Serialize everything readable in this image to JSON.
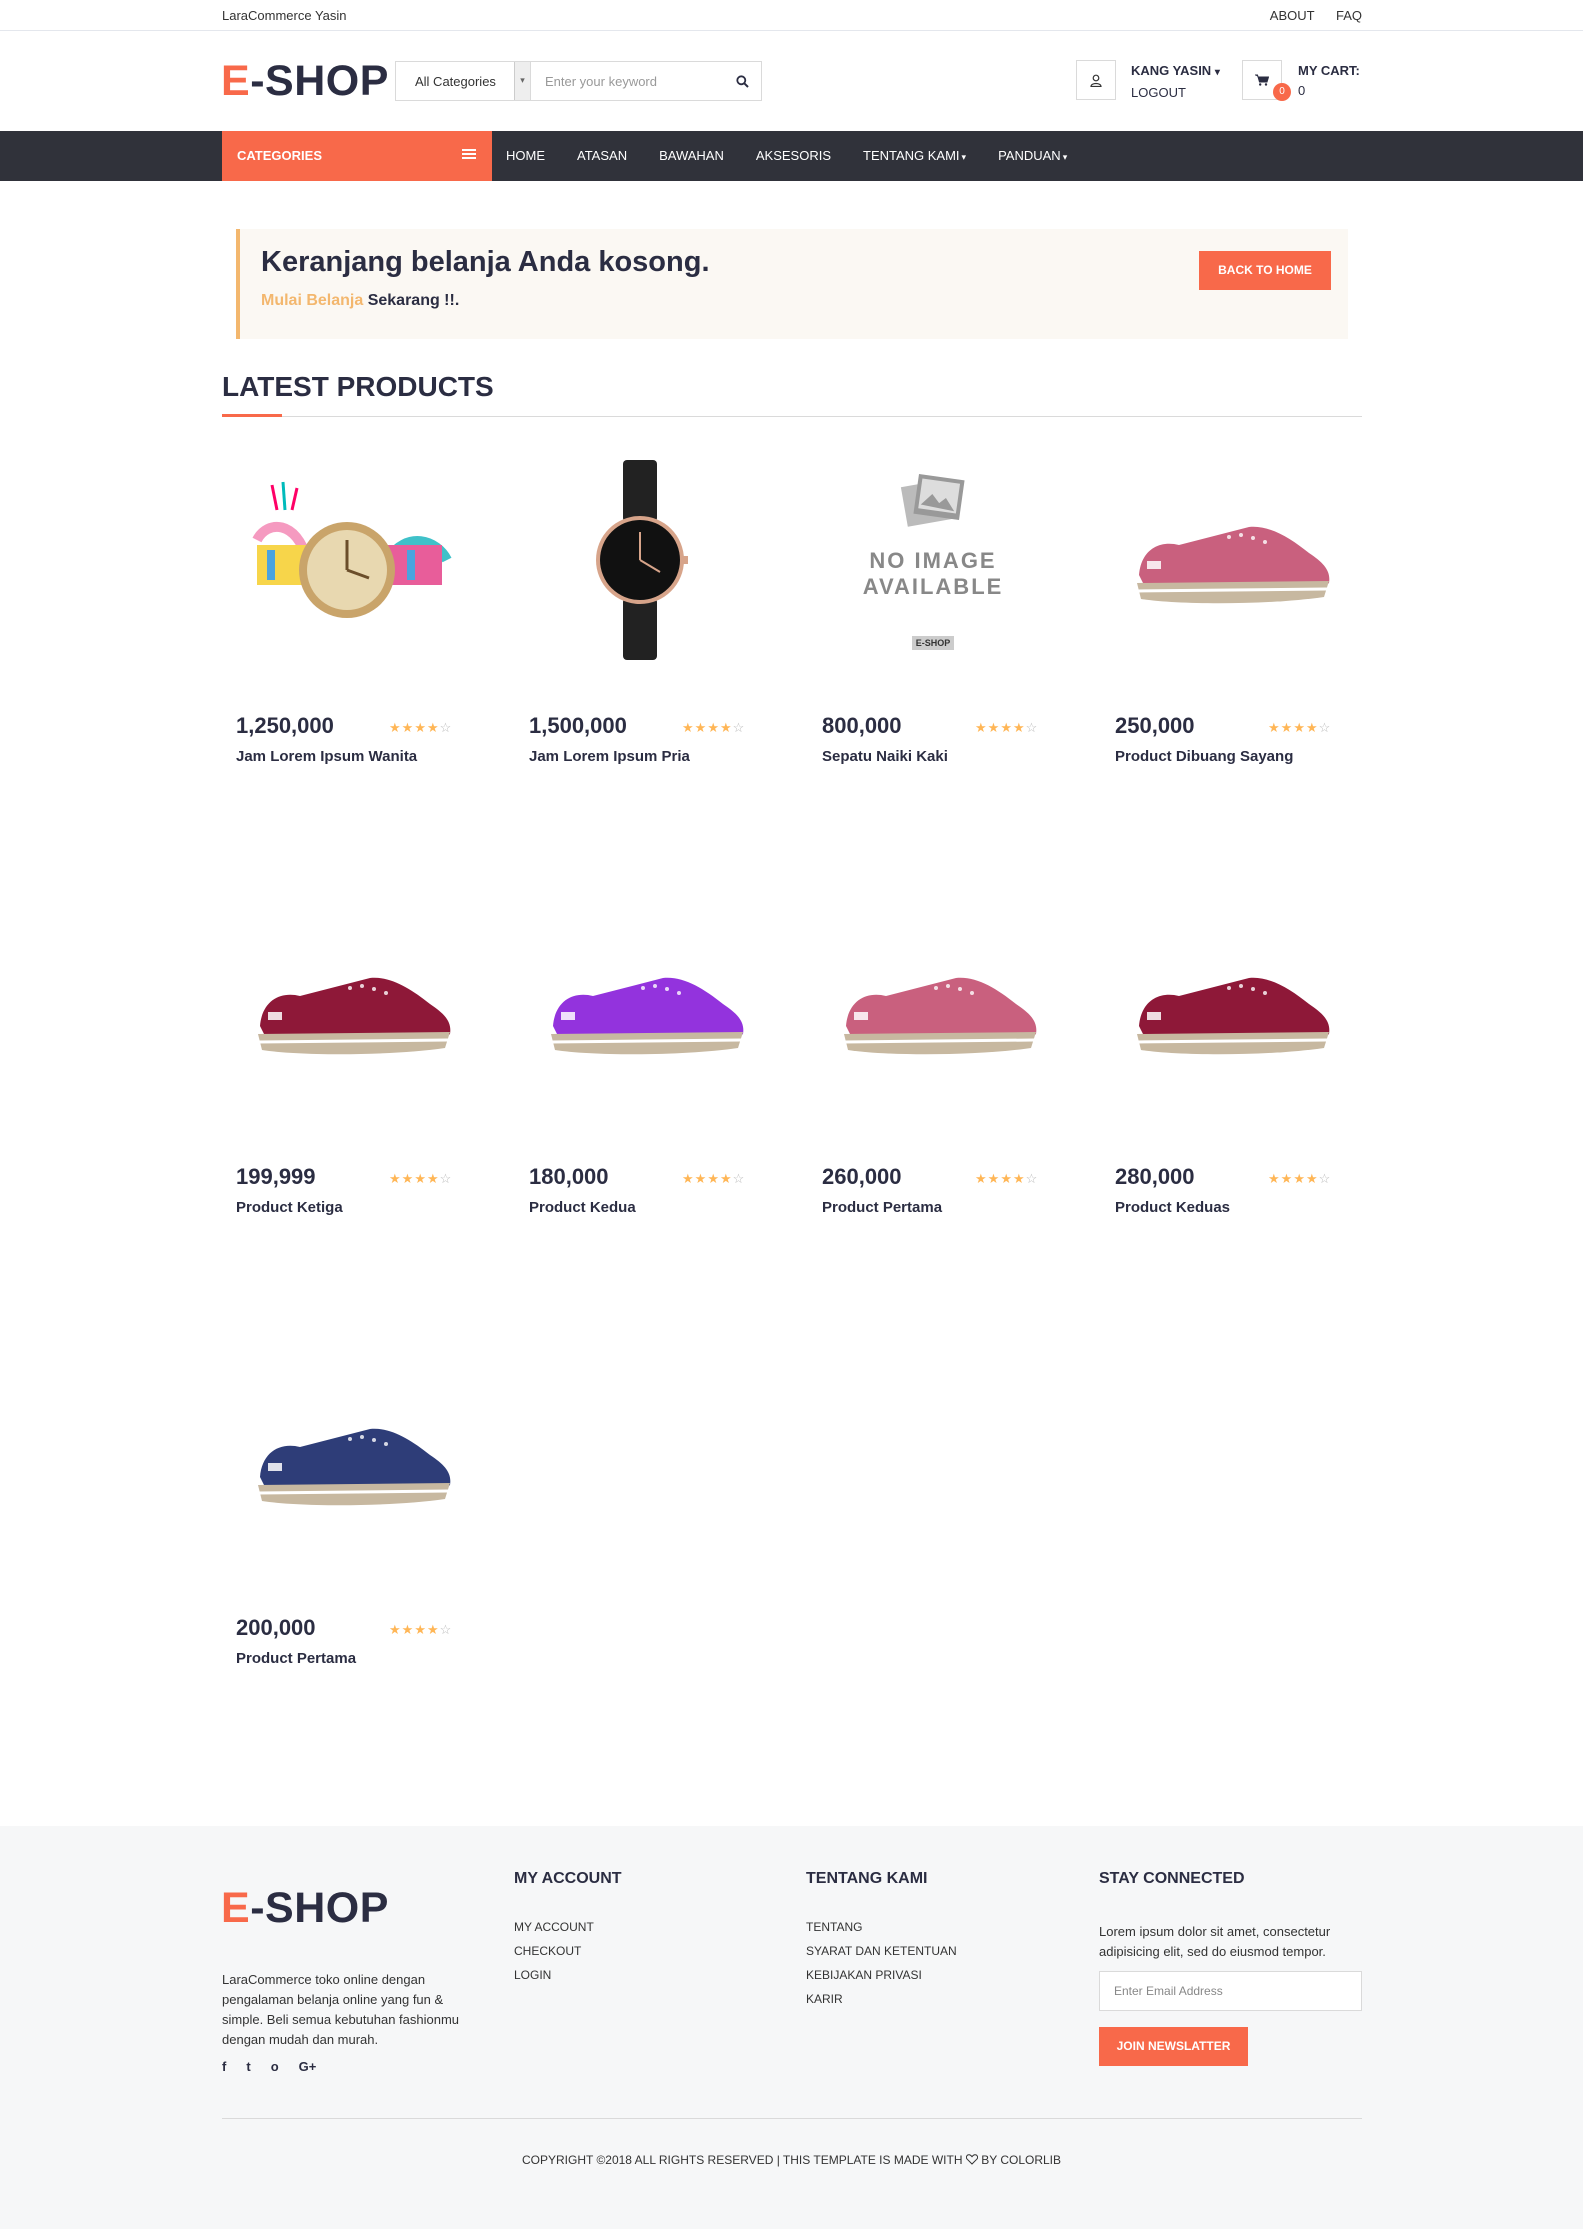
{
  "topbar": {
    "brand": "LaraCommerce Yasin",
    "links": [
      "ABOUT",
      "FAQ"
    ]
  },
  "header": {
    "logo_accent": "E",
    "logo_rest": "-SHOP",
    "search": {
      "category": "All Categories",
      "placeholder": "Enter your keyword"
    },
    "account": {
      "name": "KANG YASIN",
      "action": "LOGOUT"
    },
    "cart": {
      "label": "MY CART:",
      "value": "0",
      "badge": "0"
    }
  },
  "nav": {
    "categories_label": "CATEGORIES",
    "items": [
      {
        "label": "HOME",
        "caret": ""
      },
      {
        "label": "ATASAN",
        "caret": ""
      },
      {
        "label": "BAWAHAN",
        "caret": ""
      },
      {
        "label": "AKSESORIS",
        "caret": ""
      },
      {
        "label": "TENTANG KAMI",
        "caret": "▾"
      },
      {
        "label": "PANDUAN",
        "caret": "▾"
      }
    ]
  },
  "alert": {
    "heading": "Keranjang belanja Anda kosong.",
    "link": "Mulai Belanja",
    "rest": " Sekarang !!.",
    "button": "BACK TO HOME"
  },
  "section": {
    "title": "LATEST PRODUCTS"
  },
  "products": [
    {
      "price": "1,250,000",
      "name": "Jam Lorem Ipsum Wanita",
      "rating": 4,
      "image": "colorful-watch"
    },
    {
      "price": "1,500,000",
      "name": "Jam Lorem Ipsum Pria",
      "rating": 4,
      "image": "black-watch"
    },
    {
      "price": "800,000",
      "name": "Sepatu Naiki Kaki",
      "rating": 4,
      "image": "no-image"
    },
    {
      "price": "250,000",
      "name": "Product Dibuang Sayang",
      "rating": 4,
      "image": "pink-shoe"
    },
    {
      "price": "199,999",
      "name": "Product Ketiga",
      "rating": 4,
      "image": "maroon-shoe"
    },
    {
      "price": "180,000",
      "name": "Product Kedua",
      "rating": 4,
      "image": "purple-shoe"
    },
    {
      "price": "260,000",
      "name": "Product Pertama",
      "rating": 4,
      "image": "pink-shoe"
    },
    {
      "price": "280,000",
      "name": "Product Keduas",
      "rating": 4,
      "image": "maroon-shoe"
    },
    {
      "price": "200,000",
      "name": "Product Pertama",
      "rating": 4,
      "image": "navy-shoe"
    }
  ],
  "no_image": {
    "line1": "NO IMAGE",
    "line2": "AVAILABLE",
    "tag": "E-SHOP"
  },
  "footer": {
    "description": "LaraCommerce toko online dengan pengalaman belanja online yang fun & simple. Beli semua kebutuhan fashionmu dengan mudah dan murah.",
    "social": [
      "f",
      "t",
      "o",
      "G+"
    ],
    "my_account": {
      "title": "MY ACCOUNT",
      "items": [
        "MY ACCOUNT",
        "CHECKOUT",
        "LOGIN"
      ]
    },
    "tentang": {
      "title": "TENTANG KAMI",
      "items": [
        "TENTANG",
        "SYARAT DAN KETENTUAN",
        "KEBIJAKAN PRIVASI",
        "KARIR"
      ]
    },
    "stay": {
      "title": "STAY CONNECTED",
      "text": "Lorem ipsum dolor sit amet, consectetur adipisicing elit, sed do eiusmod tempor.",
      "placeholder": "Enter Email Address",
      "button": "JOIN NEWSLATTER"
    },
    "copyright_a": "COPYRIGHT ©2018 ALL RIGHTS RESERVED | THIS TEMPLATE IS MADE WITH",
    "copyright_b": "BY COLORLIB"
  },
  "colors": {
    "accent": "#f8694a",
    "dark": "#30323a",
    "star": "#ffb656",
    "link": "#f3b76e"
  }
}
